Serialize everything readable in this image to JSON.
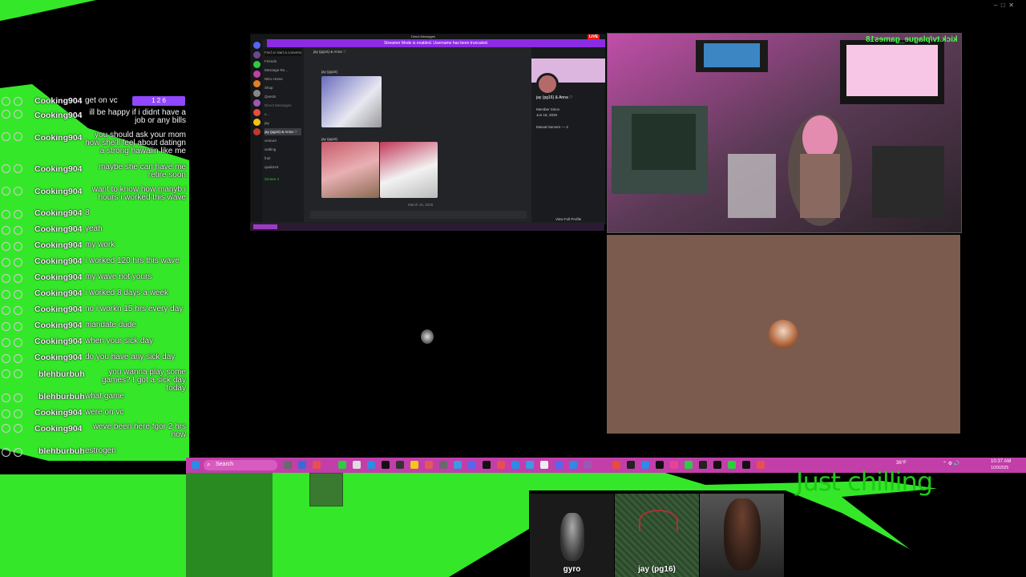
{
  "chat": {
    "messages": [
      {
        "user": "Cooking904",
        "text": "get on vc",
        "badge": "1  2  6"
      },
      {
        "user": "Cooking904",
        "text": "ill be happy if i didnt have a job or any bills"
      },
      {
        "user": "Cooking904",
        "text": "you should ask your mom how she'll feel about datingn a strong hawaiin like me"
      },
      {
        "user": "Cooking904",
        "text": "maybe she can have me retire soon"
      },
      {
        "user": "Cooking904",
        "text": "want to know how manyb i hours i worked this wave"
      },
      {
        "user": "Cooking904",
        "text": "8"
      },
      {
        "user": "Cooking904",
        "text": "yeah"
      },
      {
        "user": "Cooking904",
        "text": "my work"
      },
      {
        "user": "Cooking904",
        "text": "i worked 120 hrs this wave"
      },
      {
        "user": "Cooking904",
        "text": "my wave not yours"
      },
      {
        "user": "Cooking904",
        "text": "i worked 8 days a week"
      },
      {
        "user": "Cooking904",
        "text": "no i workn 15 hrs every day"
      },
      {
        "user": "Cooking904",
        "text": "mandate dude"
      },
      {
        "user": "Cooking904",
        "text": "when your sick day"
      },
      {
        "user": "Cooking904",
        "text": "do you have any sick day"
      },
      {
        "user": "blehburbuh",
        "text": "you wanna play some games? I got a sick day today"
      },
      {
        "user": "blehburbuh",
        "text": "what game"
      },
      {
        "user": "Cooking904",
        "text": "were on vc"
      },
      {
        "user": "Cooking904",
        "text": "weve been here fgor 2 hrs now"
      },
      {
        "user": "blehburbuh",
        "text": "estrogen"
      }
    ]
  },
  "discord": {
    "title": "Direct Messages",
    "live_badge": "LIVE",
    "banner": "Streamer Mode is enabled. Username has been truncated.",
    "search_placeholder": "Find or start a conversation",
    "nav": [
      "Friends",
      "Message Re...",
      "Nitro Home",
      "Shop",
      "Quests"
    ],
    "dm_header": "Direct Messages",
    "dm_items": [
      "jay (pg16) & Anna ♡",
      "c...",
      "jay",
      "venture",
      "settling",
      "fruit",
      "quakmnt"
    ],
    "chat_title": "jay (pg16) & Anna ♡",
    "messages": [
      {
        "author": "jay (pg16)"
      },
      {
        "author": "jay (pg16)"
      }
    ],
    "date_divider": "March 10, 2025",
    "profile": {
      "name": "jay (pg16) & Anna ♡",
      "member_since_label": "Member Since",
      "member_since": "Jun 16, 2025",
      "mutual_servers": "Mutual Servers — 4",
      "view_profile": "View Full Profile"
    },
    "screen_label": "Screen 4"
  },
  "webcam": {
    "overlay_text": "kick.tv/plague_games18"
  },
  "taskbar": {
    "search_label": "Search",
    "temp": "36°F",
    "time": "10:37 AM",
    "date": "1/20/2025"
  },
  "overlay": {
    "just_chilling": "Just chilling"
  },
  "participants": [
    {
      "name": "gyro"
    },
    {
      "name": "jay (pg16)"
    },
    {
      "name": ""
    }
  ],
  "colors": {
    "greenscreen": "#34e829",
    "taskbar": "#c23ea9",
    "discord_accent": "#8b2be2",
    "brown_tile": "#7b5b4d"
  }
}
